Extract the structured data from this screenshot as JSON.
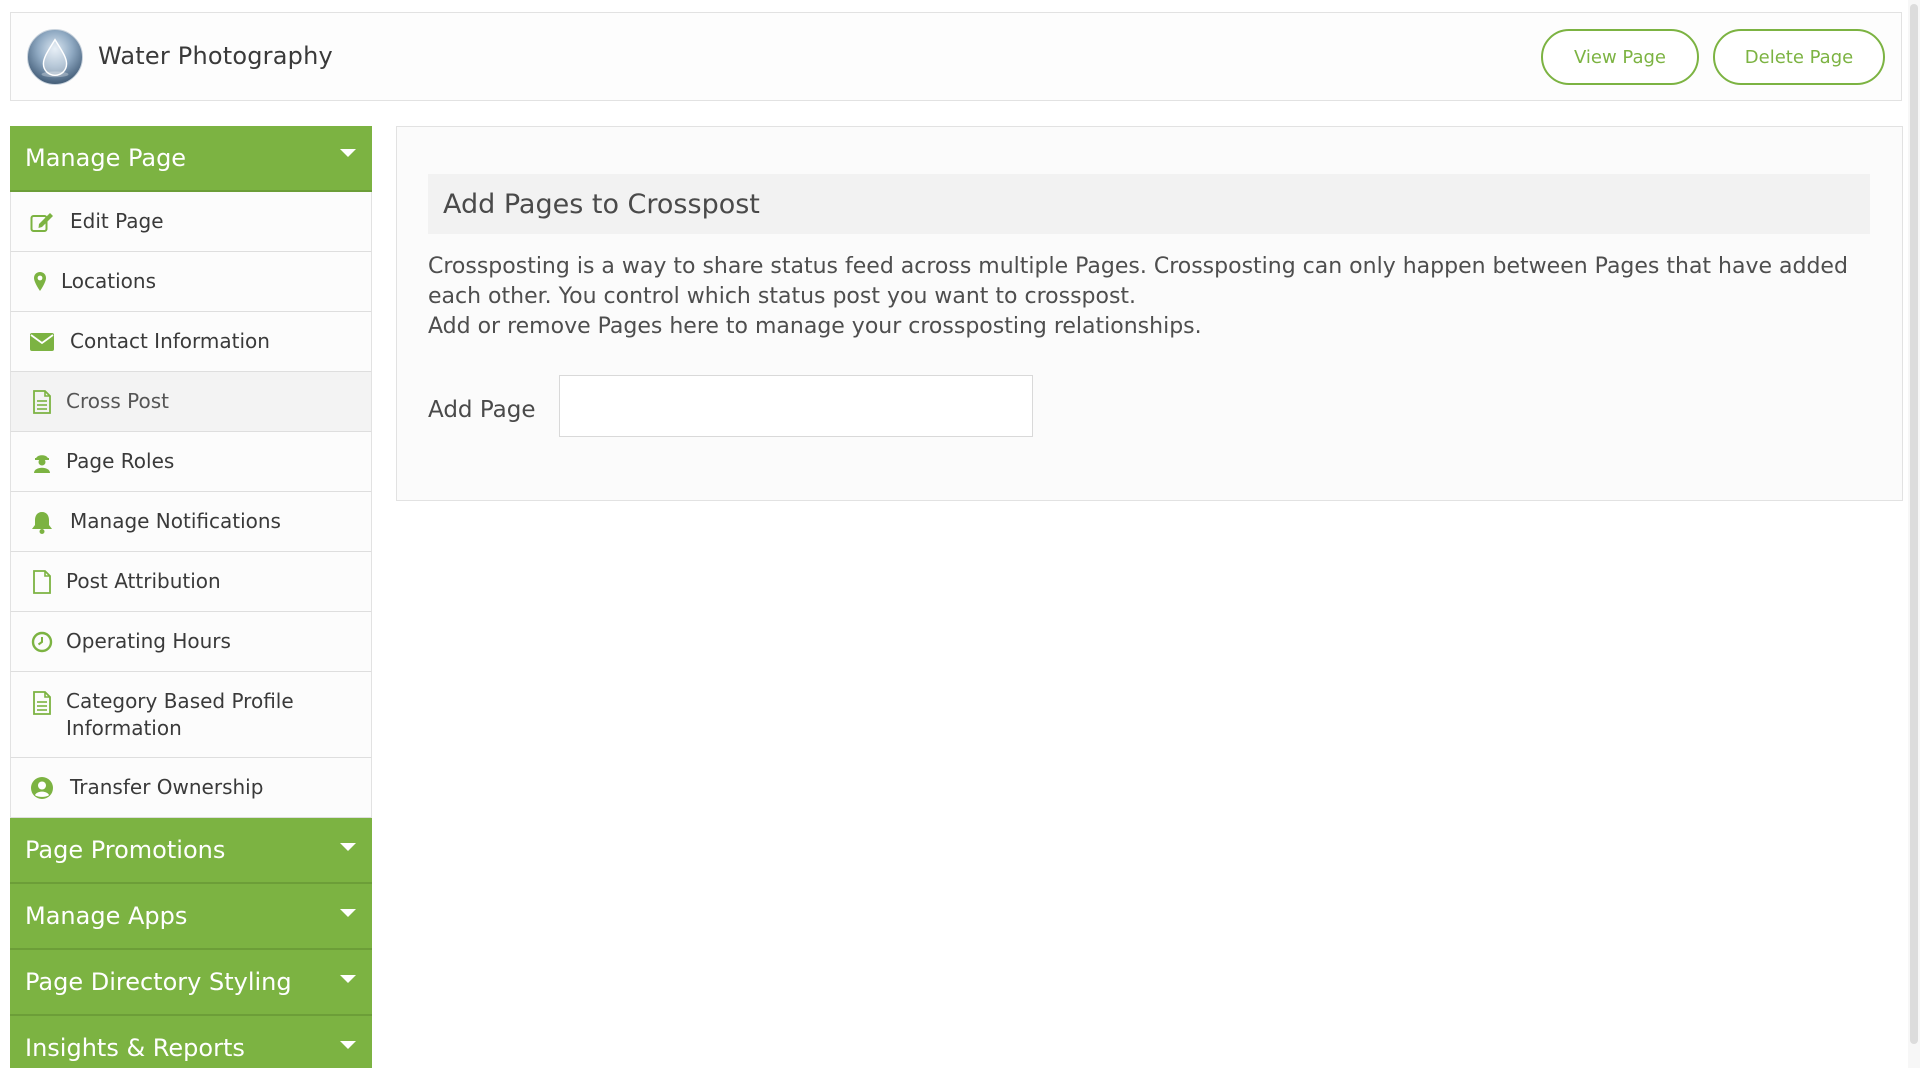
{
  "header": {
    "page_name": "Water Photography",
    "view_page_label": "View Page",
    "delete_page_label": "Delete Page"
  },
  "sidebar": {
    "manage_page": {
      "label": "Manage Page",
      "items": [
        {
          "label": "Edit Page",
          "icon": "edit-icon"
        },
        {
          "label": "Locations",
          "icon": "map-pin-icon"
        },
        {
          "label": "Contact Information",
          "icon": "envelope-icon"
        },
        {
          "label": "Cross Post",
          "icon": "document-icon",
          "active": true
        },
        {
          "label": "Page Roles",
          "icon": "user-role-icon"
        },
        {
          "label": "Manage Notifications",
          "icon": "bell-icon"
        },
        {
          "label": "Post Attribution",
          "icon": "file-icon"
        },
        {
          "label": "Operating Hours",
          "icon": "clock-icon"
        },
        {
          "label": "Category Based Profile Information",
          "icon": "document-icon"
        },
        {
          "label": "Transfer Ownership",
          "icon": "user-circle-icon"
        }
      ]
    },
    "sections": [
      {
        "label": "Page Promotions"
      },
      {
        "label": "Manage Apps"
      },
      {
        "label": "Page Directory Styling"
      },
      {
        "label": "Insights & Reports"
      }
    ]
  },
  "main": {
    "title": "Add Pages to Crosspost",
    "description_line1": "Crossposting is a way to share status feed across multiple Pages. Crossposting can only happen between Pages that have added",
    "description_line2": "each other. You control which status post you want to crosspost.",
    "description_line3": "Add or remove Pages here to manage your crossposting relationships.",
    "add_page_label": "Add Page",
    "add_page_value": "",
    "add_page_placeholder": ""
  },
  "colors": {
    "accent": "#7cb342",
    "accent_dark": "#6c9e38",
    "panel_bg": "#fbfbfb",
    "border": "#e2e2e2"
  }
}
